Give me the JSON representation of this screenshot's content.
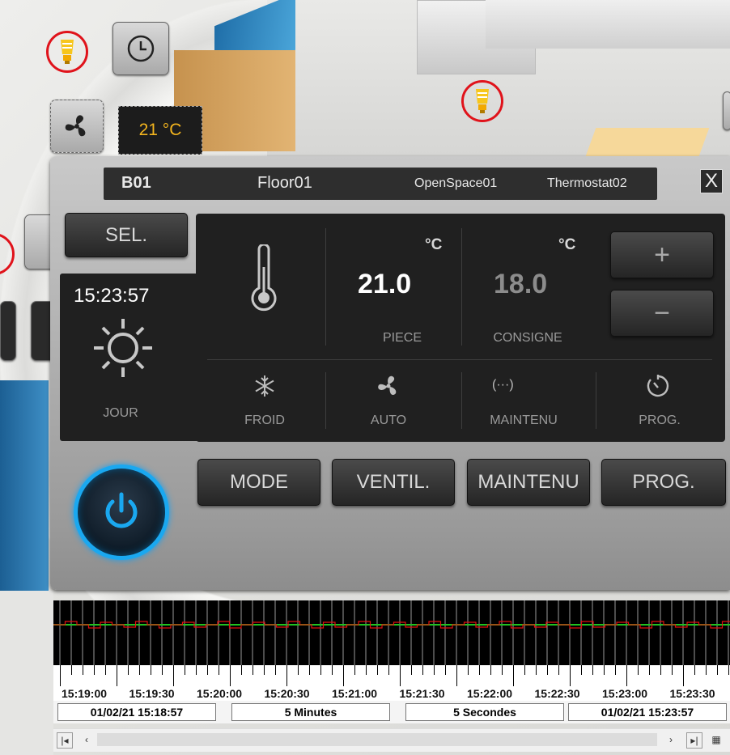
{
  "background": {
    "temperature_badge": "21 °C"
  },
  "header": {
    "building": "B01",
    "floor": "Floor01",
    "zone": "OpenSpace01",
    "device": "Thermostat02",
    "close_label": "X"
  },
  "left": {
    "sel_label": "SEL.",
    "time": "15:23:57",
    "period_label": "JOUR"
  },
  "readings": {
    "unit": "°C",
    "room_temp": "21.0",
    "room_label": "PIECE",
    "setpoint": "18.0",
    "setpoint_label": "CONSIGNE",
    "plus_label": "+",
    "minus_label": "−"
  },
  "status_icons": [
    {
      "icon": "snowflake-icon",
      "label": "FROID"
    },
    {
      "icon": "fan-icon",
      "label": "AUTO"
    },
    {
      "icon": "ellipsis-icon",
      "label": "MAINTENU"
    },
    {
      "icon": "timer-icon",
      "label": "PROG."
    }
  ],
  "actions": {
    "mode": "MODE",
    "fan": "VENTIL.",
    "hold": "MAINTENU",
    "prog": "PROG."
  },
  "colors": {
    "accent": "#1aa8f0",
    "lamp_ring": "#e0131b",
    "temp_text": "#f4b51e",
    "trend_line": "#20c020",
    "trend_signal": "#e01010"
  },
  "chart_data": {
    "type": "line",
    "x_tick_labels": [
      "15:19:00",
      "15:19:30",
      "15:20:00",
      "15:20:30",
      "15:21:00",
      "15:21:30",
      "15:22:00",
      "15:22:30",
      "15:23:00",
      "15:23:30"
    ]
  },
  "footer": {
    "start": "01/02/21 15:18:57",
    "range": "5 Minutes",
    "interval": "5 Secondes",
    "end": "01/02/21 15:23:57"
  }
}
